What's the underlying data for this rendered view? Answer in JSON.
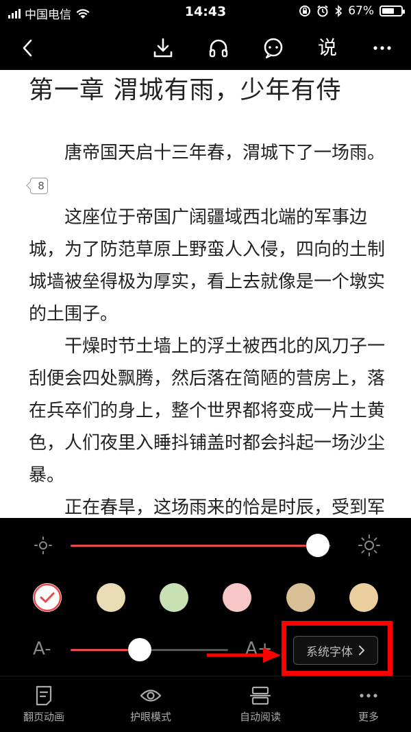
{
  "status_bar": {
    "carrier": "中国电信",
    "time": "14:43",
    "battery_percent": "67%",
    "battery_level": 0.67
  },
  "toolbar": {
    "speak_label": "说"
  },
  "reader": {
    "chapter_title": "第一章 渭城有雨，少年有侍",
    "paragraphs": [
      "唐帝国天启十三年春，渭城下了一场雨。",
      "这座位于帝国广阔疆域西北端的军事边城，为了防范草原上野蛮人入侵，四向的土制城墙被垒得极为厚实，看上去就像是一个墩实的土围子。",
      "干燥时节土墙上的浮土被西北的风刀子一刮便会四处飘腾，然后落在简陋的营房上，落在兵卒们的身上，整个世界都将变成一片土黄色，人们夜里入睡抖铺盖时都会抖起一场沙尘暴。",
      "正在春旱，这场雨来的恰是时辰，受到军卒们的热烈欢迎，甚至有不少人特意跑到营房外淋雨。"
    ],
    "note_count": "8"
  },
  "panel": {
    "brightness_level": 0.95,
    "font_size_level": 0.44,
    "font_decrease_label": "A-",
    "font_increase_label": "A+",
    "font_button_label": "系统字体",
    "themes": [
      {
        "name": "white",
        "color": "#ffffff",
        "selected": true
      },
      {
        "name": "beige",
        "color": "#e8dcb5",
        "selected": false
      },
      {
        "name": "green",
        "color": "#c9e0b4",
        "selected": false
      },
      {
        "name": "pink",
        "color": "#f7c6c6",
        "selected": false
      },
      {
        "name": "wood",
        "color": "#d9bf95",
        "selected": false
      },
      {
        "name": "light-wood",
        "color": "#eccf9f",
        "selected": false
      }
    ],
    "accent_color": "#e84a4a"
  },
  "tabbar": {
    "page_turn_label": "翻页动画",
    "eye_care_label": "护眼模式",
    "auto_read_label": "自动阅读",
    "more_label": "更多"
  }
}
